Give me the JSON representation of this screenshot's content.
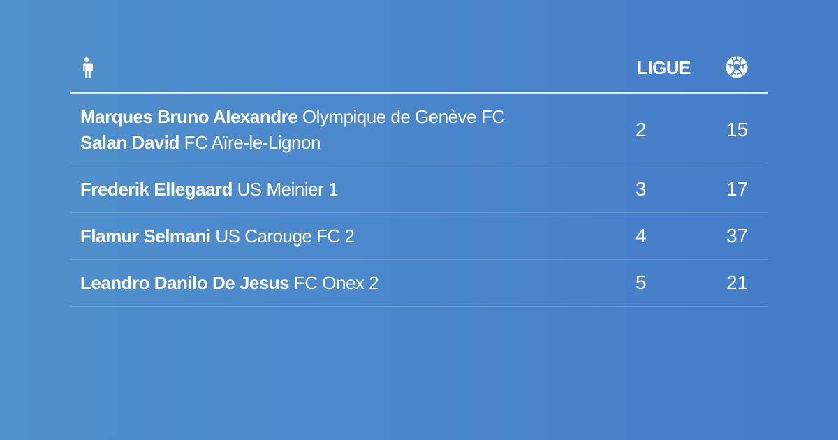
{
  "header": {
    "player_icon": "person-icon",
    "league_label": "LIGUE",
    "goals_icon": "soccer-ball-icon"
  },
  "rows": [
    {
      "players": [
        {
          "name": "Marques Bruno Alexandre",
          "club": "Olympique de Genève FC"
        },
        {
          "name": "Salan David",
          "club": "FC Aïre-le-Lignon"
        }
      ],
      "league": "2",
      "goals": "15"
    },
    {
      "players": [
        {
          "name": "Frederik Ellegaard",
          "club": "US Meinier 1"
        }
      ],
      "league": "3",
      "goals": "17"
    },
    {
      "players": [
        {
          "name": "Flamur Selmani",
          "club": "US Carouge FC 2"
        }
      ],
      "league": "4",
      "goals": "37"
    },
    {
      "players": [
        {
          "name": "Leandro Danilo De Jesus",
          "club": "FC Onex 2"
        }
      ],
      "league": "5",
      "goals": "21"
    }
  ],
  "colors": {
    "background_start": "#5090cb",
    "background_end": "#437bc8",
    "text": "#ffffff"
  }
}
